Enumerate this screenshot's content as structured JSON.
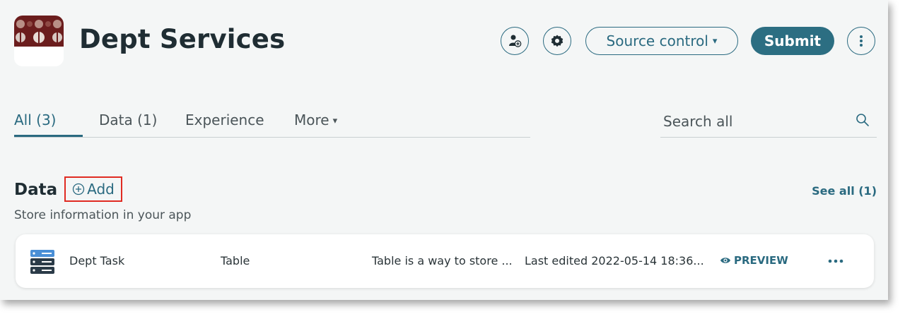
{
  "app": {
    "title": "Dept Services",
    "logo_icon": "dept-logo-pattern"
  },
  "toolbar": {
    "add_user_icon": "person-plus-icon",
    "settings_icon": "gear-icon",
    "source_control_label": "Source control",
    "source_control_caret": "▾",
    "submit_label": "Submit",
    "more_icon": "vertical-ellipsis-icon"
  },
  "tabs": [
    {
      "label": "All (3)",
      "active": true
    },
    {
      "label": "Data (1)",
      "active": false
    },
    {
      "label": "Experience",
      "active": false
    },
    {
      "label": "More",
      "active": false,
      "caret": "▾"
    }
  ],
  "search": {
    "placeholder": "Search all",
    "icon": "search-icon"
  },
  "section": {
    "title": "Data",
    "add_label": "Add",
    "subtitle": "Store information in your app",
    "see_all_label": "See all (1)"
  },
  "rows": [
    {
      "icon": "table-icon",
      "name": "Dept Task",
      "type": "Table",
      "description": "Table is a way to store ...",
      "last_edited": "Last edited 2022-05-14 18:36...",
      "preview_label": "PREVIEW",
      "more_icon": "horizontal-ellipsis-icon"
    }
  ],
  "colors": {
    "accent": "#2a6a80",
    "submit_bg": "#2c6e82",
    "highlight_border": "#e02b22",
    "page_bg": "#f4f6f6",
    "logo_maroon": "#6b1d1d"
  }
}
